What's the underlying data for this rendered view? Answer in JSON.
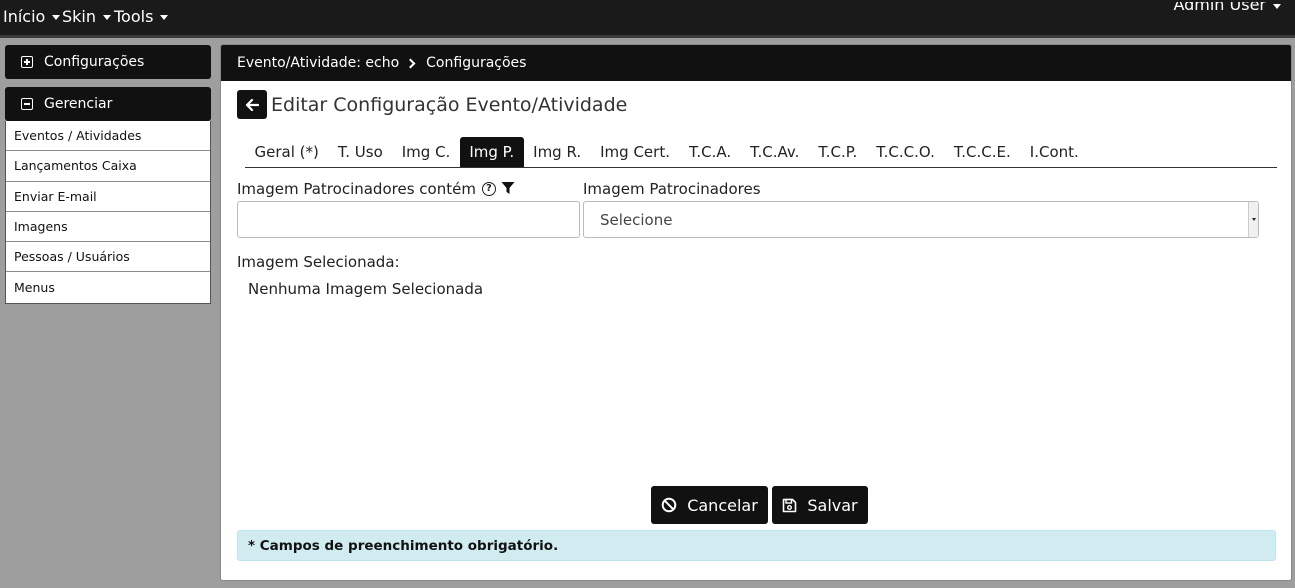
{
  "topbar": {
    "menus": [
      {
        "label": "Início"
      },
      {
        "label": "Skin"
      },
      {
        "label": "Tools"
      }
    ],
    "user_label": "Admin User"
  },
  "sidebar": {
    "sections": [
      {
        "label": "Configurações",
        "icon": "plus-square-icon",
        "expanded": false
      },
      {
        "label": "Gerenciar",
        "icon": "minus-square-icon",
        "expanded": true
      }
    ],
    "items": [
      {
        "label": "Eventos / Atividades"
      },
      {
        "label": "Lançamentos Caixa"
      },
      {
        "label": "Enviar E-mail"
      },
      {
        "label": "Imagens"
      },
      {
        "label": "Pessoas / Usuários"
      },
      {
        "label": "Menus"
      }
    ]
  },
  "breadcrumb": {
    "first": "Evento/Atividade: echo",
    "second": "Configurações"
  },
  "page": {
    "title": "Editar Configuração Evento/Atividade"
  },
  "tabs": [
    {
      "label": "Geral (*)",
      "active": false
    },
    {
      "label": "T. Uso",
      "active": false
    },
    {
      "label": "Img C.",
      "active": false
    },
    {
      "label": "Img P.",
      "active": true
    },
    {
      "label": "Img R.",
      "active": false
    },
    {
      "label": "Img Cert.",
      "active": false
    },
    {
      "label": "T.C.A.",
      "active": false
    },
    {
      "label": "T.C.Av.",
      "active": false
    },
    {
      "label": "T.C.P.",
      "active": false
    },
    {
      "label": "T.C.C.O.",
      "active": false
    },
    {
      "label": "T.C.C.E.",
      "active": false
    },
    {
      "label": "I.Cont.",
      "active": false
    }
  ],
  "form": {
    "filter_label": "Imagem Patrocinadores contém",
    "filter_value": "",
    "select_label": "Imagem Patrocinadores",
    "select_value": "Selecione",
    "selected_label": "Imagem Selecionada:",
    "selected_value": "Nenhuma Imagem Selecionada"
  },
  "buttons": {
    "cancel": "Cancelar",
    "save": "Salvar"
  },
  "note": "* Campos de preenchimento obrigatório."
}
